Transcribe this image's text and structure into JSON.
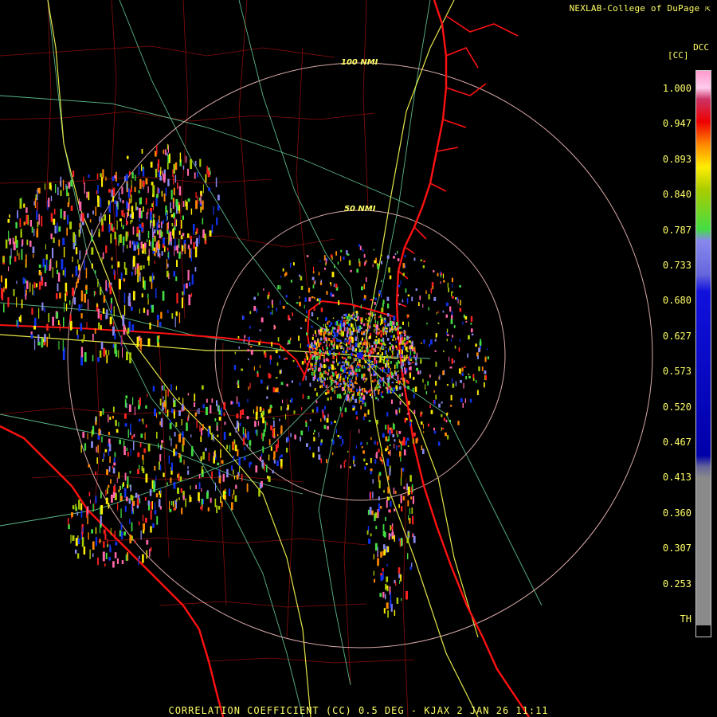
{
  "header": {
    "credit": "NEXLAB-College of DuPage"
  },
  "product": {
    "short": "DCC",
    "unit": "[CC]"
  },
  "rings": {
    "inner_label": "50 NMI",
    "outer_label": "100 NMI"
  },
  "colorbar": {
    "ticks": [
      "1.000",
      "0.947",
      "0.893",
      "0.840",
      "0.787",
      "0.733",
      "0.680",
      "0.627",
      "0.573",
      "0.520",
      "0.467",
      "0.413",
      "0.360",
      "0.307",
      "0.253",
      "TH"
    ],
    "colors": {
      "pink": "#ff99cc",
      "red": "#ee0000",
      "orange": "#ff8800",
      "yellow": "#ffee00",
      "green": "#44dd44",
      "lavender": "#8888ee",
      "blue": "#1111dd",
      "gray": "#8a8a8a",
      "black": "#000000"
    }
  },
  "map_colors": {
    "coast": "#ff1111",
    "state_border": "#ff1111",
    "county_lines": "#aa1111",
    "highways": "#e6e64a",
    "roads": "#66cc99",
    "range_rings": "#d8a8a8"
  },
  "footer": {
    "caption": "CORRELATION COEFFICIENT (CC) 0.5 DEG - KJAX 2 JAN 26 11:11"
  }
}
